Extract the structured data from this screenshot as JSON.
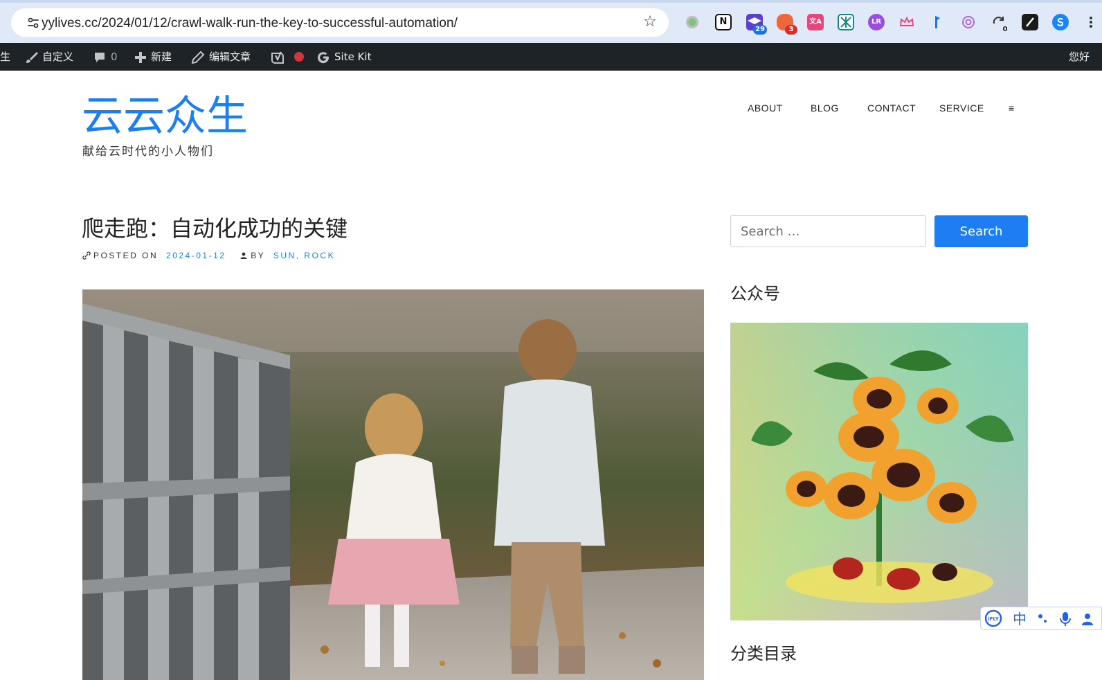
{
  "browser": {
    "url": "yylives.cc/2024/01/12/crawl-walk-run-the-key-to-successful-automation/",
    "extensions": [
      {
        "name": "circle-extension",
        "badge": ""
      },
      {
        "name": "notion-extension",
        "label": "N",
        "badge": ""
      },
      {
        "name": "graduation-cap-extension",
        "badge": "29"
      },
      {
        "name": "chat-bubbles-extension",
        "badge": "3"
      },
      {
        "name": "translate-extension",
        "label": "文A",
        "badge": ""
      },
      {
        "name": "pattern-extension",
        "badge": ""
      },
      {
        "name": "lr-extension",
        "label": "LR",
        "badge": ""
      },
      {
        "name": "crown-extension",
        "badge": ""
      },
      {
        "name": "blue-flag-extension",
        "badge": ""
      },
      {
        "name": "openai-extension",
        "badge": ""
      },
      {
        "name": "refresh-extension",
        "badge": "0"
      },
      {
        "name": "dark-slash-extension",
        "badge": ""
      },
      {
        "name": "blue-s-extension",
        "badge": ""
      }
    ]
  },
  "adminbar": {
    "site_fragment": "生",
    "customize": "自定义",
    "comments_count": "0",
    "new": "新建",
    "edit_post": "编辑文章",
    "sitekit": "Site Kit",
    "greeting_fragment": "您好"
  },
  "site": {
    "title": "云云众生",
    "description": "献给云时代的小人物们"
  },
  "nav": {
    "items": [
      "ABOUT",
      "BLOG",
      "CONTACT",
      "SERVICE"
    ],
    "menu_icon": "≡"
  },
  "post": {
    "title": "爬走跑：自动化成功的关键",
    "posted_on_label": "POSTED ON",
    "date": "2024-01-12",
    "by_label": "BY",
    "author": "SUN, ROCK"
  },
  "sidebar": {
    "search_placeholder": "Search …",
    "search_button": "Search",
    "widget_wechat": "公众号",
    "widget_categories": "分类目录"
  },
  "ime": {
    "mode": "中"
  },
  "colors": {
    "accent": "#1c7ef2",
    "adminbar_bg": "#1d2327",
    "adminbar_dot": "#d63638",
    "chrome_bg": "#dfe9f7"
  }
}
